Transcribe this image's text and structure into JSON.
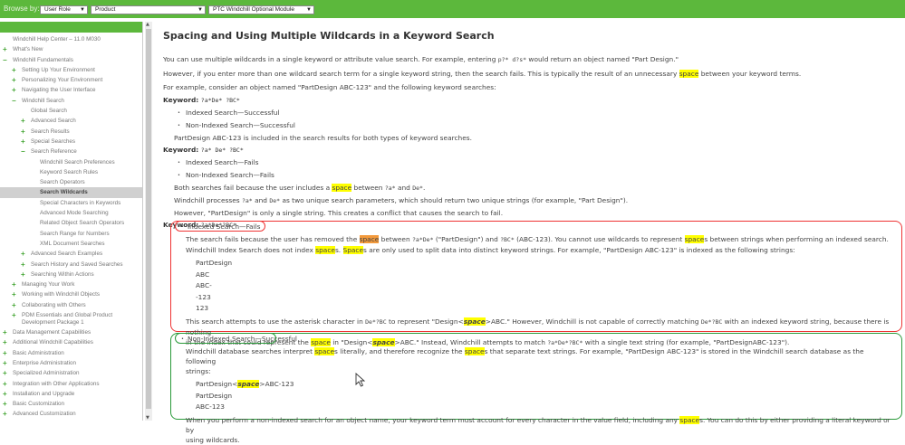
{
  "topbar": {
    "browse_label": "Browse by:",
    "selects": [
      "User Role",
      "Product",
      "PTC Windchill Optional Module"
    ]
  },
  "sidebar": {
    "items": [
      {
        "l": 0,
        "p": "",
        "t": "Windchill Help Center – 11.0 M030"
      },
      {
        "l": 0,
        "p": "+",
        "t": "What's New"
      },
      {
        "l": 0,
        "p": "−",
        "t": "Windchill Fundamentals"
      },
      {
        "l": 1,
        "p": "+",
        "t": "Setting Up Your Environment"
      },
      {
        "l": 1,
        "p": "+",
        "t": "Personalizing Your Environment"
      },
      {
        "l": 1,
        "p": "+",
        "t": "Navigating the User Interface"
      },
      {
        "l": 1,
        "p": "−",
        "t": "Windchill Search"
      },
      {
        "l": 2,
        "p": "",
        "t": "Global Search"
      },
      {
        "l": 2,
        "p": "+",
        "t": "Advanced Search"
      },
      {
        "l": 2,
        "p": "+",
        "t": "Search Results"
      },
      {
        "l": 2,
        "p": "+",
        "t": "Special Searches"
      },
      {
        "l": 2,
        "p": "−",
        "t": "Search Reference"
      },
      {
        "l": 3,
        "p": "",
        "t": "Windchill Search Preferences"
      },
      {
        "l": 3,
        "p": "",
        "t": "Keyword Search Rules"
      },
      {
        "l": 3,
        "p": "",
        "t": "Search Operators"
      },
      {
        "l": 3,
        "p": "",
        "t": "Search Wildcards",
        "active": true
      },
      {
        "l": 3,
        "p": "",
        "t": "Special Characters in Keywords"
      },
      {
        "l": 3,
        "p": "",
        "t": "Advanced Mode Searching"
      },
      {
        "l": 3,
        "p": "",
        "t": "Related Object Search Operators"
      },
      {
        "l": 3,
        "p": "",
        "t": "Search Range for Numbers"
      },
      {
        "l": 3,
        "p": "",
        "t": "XML Document Searches"
      },
      {
        "l": 2,
        "p": "+",
        "t": "Advanced Search Examples"
      },
      {
        "l": 2,
        "p": "+",
        "t": "Search History and Saved Searches"
      },
      {
        "l": 2,
        "p": "+",
        "t": "Searching Within Actions"
      },
      {
        "l": 1,
        "p": "+",
        "t": "Managing Your Work"
      },
      {
        "l": 1,
        "p": "+",
        "t": "Working with Windchill Objects"
      },
      {
        "l": 1,
        "p": "+",
        "t": "Collaborating with Others"
      },
      {
        "l": 1,
        "p": "+",
        "t": "PDM Essentials and Global Product Development Package 1",
        "two": true
      },
      {
        "l": 0,
        "p": "+",
        "t": "Data Management Capabilities"
      },
      {
        "l": 0,
        "p": "+",
        "t": "Additional Windchill Capabilities"
      },
      {
        "l": 0,
        "p": "+",
        "t": "Basic Administration"
      },
      {
        "l": 0,
        "p": "+",
        "t": "Enterprise Administration"
      },
      {
        "l": 0,
        "p": "+",
        "t": "Specialized Administration"
      },
      {
        "l": 0,
        "p": "+",
        "t": "Integration with Other Applications"
      },
      {
        "l": 0,
        "p": "+",
        "t": "Installation and Upgrade"
      },
      {
        "l": 0,
        "p": "+",
        "t": "Basic Customization"
      },
      {
        "l": 0,
        "p": "+",
        "t": "Advanced Customization"
      }
    ]
  },
  "main": {
    "title": "Spacing and Using Multiple Wildcards in a Keyword Search",
    "blocks": [
      {
        "c": "p",
        "s": [
          [
            "You can use multiple wildcards in a single keyword or attribute value search. For example, entering "
          ],
          [
            "p?* d?s*",
            "code"
          ],
          [
            " would return an object named \"Part Design.\""
          ]
        ]
      },
      {
        "c": "p",
        "s": [
          [
            "However, if you enter more than one wildcard search term for a single keyword string, then the search fails. This is typically the result of an unnecessary "
          ],
          [
            "space",
            "hl"
          ],
          [
            " between your keyword terms."
          ]
        ]
      },
      {
        "c": "p",
        "s": [
          [
            "For example, consider an object named \"PartDesign ABC-123\" and the following keyword searches:"
          ]
        ]
      },
      {
        "c": "kw",
        "s": [
          [
            "Keyword: "
          ],
          [
            "?a*De* ?BC*",
            "code"
          ]
        ]
      },
      {
        "c": "bul",
        "s": [
          [
            "Indexed Search—Successful"
          ]
        ]
      },
      {
        "c": "bul",
        "s": [
          [
            "Non-Indexed Search—Successful"
          ]
        ]
      },
      {
        "c": "ind",
        "s": [
          [
            "PartDesign ABC-123 is included in the search results for both types of keyword searches."
          ]
        ]
      },
      {
        "c": "kw",
        "s": [
          [
            "Keyword: "
          ],
          [
            "?a* De* ?BC*",
            "code"
          ]
        ]
      },
      {
        "c": "bul",
        "s": [
          [
            "Indexed Search—Fails"
          ]
        ]
      },
      {
        "c": "bul",
        "s": [
          [
            "Non-Indexed Search—Fails"
          ]
        ]
      },
      {
        "c": "ind",
        "s": [
          [
            "Both searches fail because the user includes a "
          ],
          [
            "space",
            "hl"
          ],
          [
            " between "
          ],
          [
            "?a*",
            "code"
          ],
          [
            " and "
          ],
          [
            "De*",
            "code"
          ],
          [
            "."
          ]
        ]
      },
      {
        "c": "ind",
        "s": [
          [
            " Windchill processes "
          ],
          [
            "?a*",
            "code"
          ],
          [
            " and "
          ],
          [
            "De*",
            "code"
          ],
          [
            " as two unique search parameters, which should return two unique strings (for example, \"Part Design\")."
          ]
        ]
      },
      {
        "c": "ind",
        "s": [
          [
            "However, \"PartDesign\" is only a single string. This creates a conflict that causes the search to fail."
          ]
        ]
      },
      {
        "c": "kw",
        "s": [
          [
            "Keyword: "
          ],
          [
            "?a*De*?BC*",
            "code"
          ]
        ]
      }
    ],
    "indexed": {
      "title": "Indexed Search—Fails",
      "p1": [
        [
          "The search fails because the user has removed the "
        ],
        [
          "space",
          "hlo"
        ],
        [
          " between "
        ],
        [
          "?a*De*",
          "code"
        ],
        [
          " (\"PartDesign\") and "
        ],
        [
          "?BC*",
          "code"
        ],
        [
          " (ABC-123). You cannot use wildcards to represent "
        ],
        [
          "space",
          "hl"
        ],
        [
          "s between strings when performing an indexed search."
        ]
      ],
      "p2": [
        [
          " Windchill Index Search does not index "
        ],
        [
          "space",
          "hl"
        ],
        [
          "s. "
        ],
        [
          "Space",
          "hl"
        ],
        [
          "s are only used to split data into distinct keyword strings. For example, \"PartDesign ABC-123\" is indexed as the following strings:"
        ]
      ],
      "list": [
        "PartDesign",
        "ABC",
        "ABC-",
        "-123",
        "123"
      ],
      "p3": [
        [
          "This search attempts to use the asterisk character in "
        ],
        [
          "De*?BC",
          "code"
        ],
        [
          " to represent \"Design<"
        ],
        [
          "space",
          "hli"
        ],
        [
          ">ABC.\" However,  Windchill is not capable of correctly matching "
        ],
        [
          "De*?BC",
          "code"
        ],
        [
          " with an indexed keyword string, because there is nothing"
        ]
      ],
      "p4": [
        [
          "in the index that could represent the "
        ],
        [
          "space",
          "hl"
        ],
        [
          " in \"Design<"
        ],
        [
          "space",
          "hli"
        ],
        [
          ">ABC.\" Instead,  Windchill attempts to match "
        ],
        [
          "?a*De*?BC*",
          "code"
        ],
        [
          " with a single text string (for example, \"PartDesignABC-123\")."
        ]
      ]
    },
    "nonindexed": {
      "title": "Non-Indexed Search—Successful",
      "p1": [
        [
          " Windchill database searches interpret "
        ],
        [
          "space",
          "hl"
        ],
        [
          "s literally, and therefore recognize the "
        ],
        [
          "space",
          "hl"
        ],
        [
          "s that separate text strings. For example, \"PartDesign ABC-123\" is stored in the  Windchill search database as the following"
        ]
      ],
      "p2": [
        [
          "strings:"
        ]
      ],
      "list": [
        [
          [
            "PartDesign<"
          ],
          [
            "space",
            "hli"
          ],
          [
            ">ABC-123"
          ]
        ],
        [
          [
            "PartDesign"
          ]
        ],
        [
          [
            "ABC-123"
          ]
        ]
      ],
      "p3": [
        [
          "When you perform a non-indexed search for an object name, your keyword term must account for every character in the value field, including any "
        ],
        [
          "space",
          "hl"
        ],
        [
          "s. You can do this by either providing a literal keyword or by"
        ]
      ],
      "p4": [
        [
          "using wildcards."
        ]
      ]
    }
  }
}
